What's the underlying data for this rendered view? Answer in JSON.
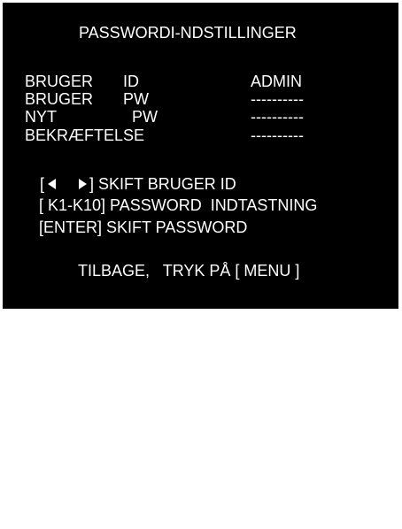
{
  "osd": {
    "title": "PASSWORDI-NDSTILLINGER",
    "rows": [
      {
        "label": "BRUGER",
        "field": "ID",
        "value": "ADMIN"
      },
      {
        "label": "BRUGER",
        "field": "PW",
        "value": "----------"
      },
      {
        "label": "NYT",
        "field": "PW",
        "value": "----------"
      },
      {
        "label": "BEKRÆFTELSE",
        "field": "",
        "value": "----------"
      }
    ],
    "help": {
      "arrows_open": "[",
      "left_arrow_icon": "left-triangle-icon",
      "right_arrow_icon": "right-triangle-icon",
      "arrows_text": "] SKIFT BRUGER ID",
      "keys_text": "[ K1-K10] PASSWORD  INDTASTNING",
      "enter_text": "[ENTER] SKIFT PASSWORD"
    },
    "footer": "TILBAGE,   TRYK PÅ [ MENU ]"
  }
}
